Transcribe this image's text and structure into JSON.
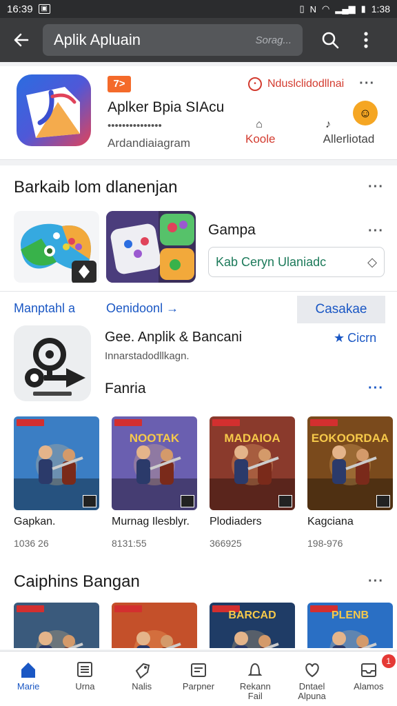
{
  "status_bar": {
    "time_left": "16:39",
    "time_right": "1:38"
  },
  "top_bar": {
    "query": "Aplik Apluain",
    "hint": "Sorag..."
  },
  "featured_app": {
    "badge": "7>",
    "alert_text": "Nduslclidodllnai",
    "title": "Aplker Bpia SIAcu",
    "subtitle": "•••••••••••••••",
    "developer": "Ardandiaiagram",
    "stat_mid_label": "Koole",
    "stat_right_label": "Allerliotad"
  },
  "section_recommend": {
    "title": "Barkaib lom dlanenjan",
    "gampa_label": "Gampa",
    "chip_text": "Kab Ceryn Ulaniadc"
  },
  "links_row": {
    "left": "Manptahl a",
    "mid": "Oenidoonl",
    "button": "Casakae"
  },
  "app_row": {
    "title": "Gee. Anplik & Bancani",
    "subtitle": "Innarstadodllkagn.",
    "fanria": "Fanria",
    "rating_label": "Cicrn"
  },
  "games_row": [
    {
      "title": "Gapkan.",
      "meta": "1036 26",
      "art": "",
      "accent": "#3b7ec4"
    },
    {
      "title": "Murnag Ilesblyr.",
      "meta": "8131:55",
      "art": "NOOTAK",
      "accent": "#6a5fb0"
    },
    {
      "title": "Plodiaders",
      "meta": "366925",
      "art": "MADAIOA",
      "accent": "#8a3a2c"
    },
    {
      "title": "Kagciana",
      "meta": "198-976",
      "art": "EOKOORDAA",
      "accent": "#7a4a1c"
    }
  ],
  "section_popular": {
    "title": "Caiphins Bangan"
  },
  "games_row2": [
    {
      "accent": "#3a5a7c",
      "art": ""
    },
    {
      "accent": "#c4502a",
      "art": ""
    },
    {
      "accent": "#1f3c66",
      "art": "BARCAD"
    },
    {
      "accent": "#2a6fc4",
      "art": "PLENB"
    }
  ],
  "bottom_nav": [
    {
      "label": "Marie",
      "icon": "home-icon"
    },
    {
      "label": "Urna",
      "icon": "list-icon"
    },
    {
      "label": "Nalis",
      "icon": "tag-icon"
    },
    {
      "label": "Parpner",
      "icon": "wallet-icon"
    },
    {
      "label": "Rekann\nFail",
      "icon": "bell-icon"
    },
    {
      "label": "Dntael\nAlpuna",
      "icon": "heart-icon"
    },
    {
      "label": "Alamos",
      "icon": "inbox-icon"
    }
  ],
  "notif_count": "1",
  "colors": {
    "accent": "#1a57c4",
    "alert": "#d33b2f",
    "badge": "#f46a2a"
  }
}
